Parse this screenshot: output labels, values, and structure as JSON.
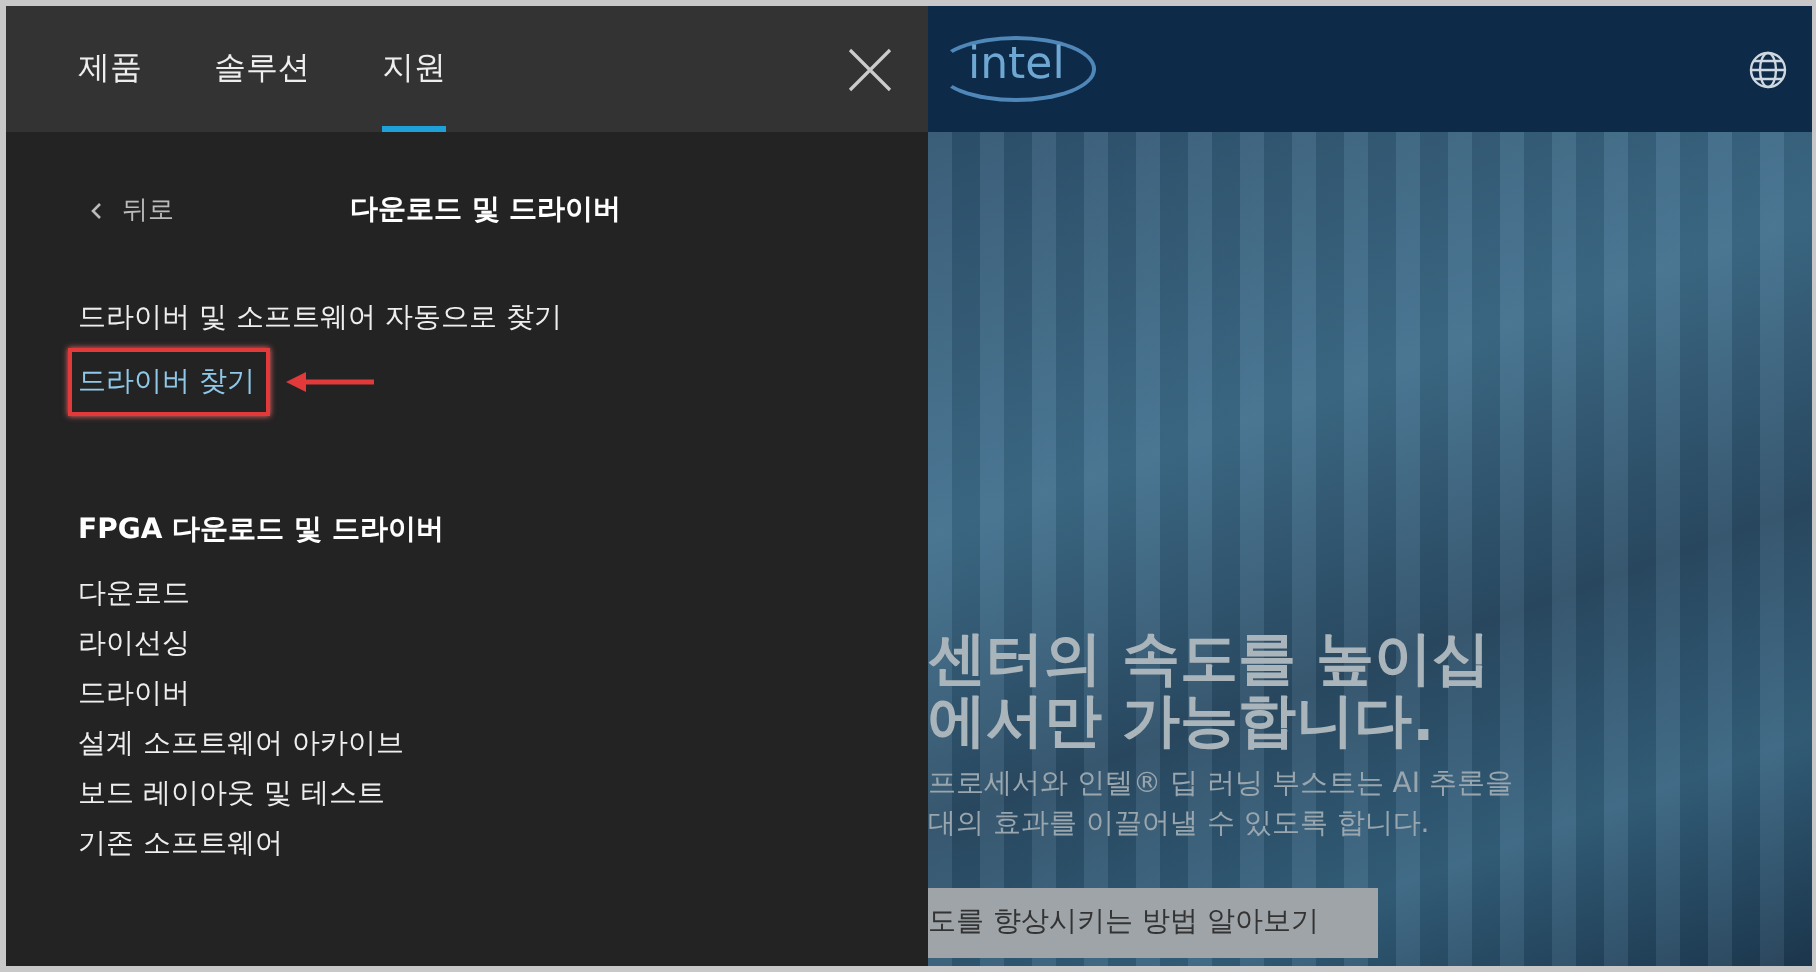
{
  "nav": {
    "tabs": [
      {
        "label": "제품",
        "selected": false
      },
      {
        "label": "솔루션",
        "selected": false
      },
      {
        "label": "지원",
        "selected": true
      }
    ]
  },
  "menu": {
    "back": "뒤로",
    "title": "다운로드 및 드라이버",
    "links": [
      {
        "label": "드라이버 및 소프트웨어 자동으로 찾기",
        "annotated": false
      },
      {
        "label": "드라이버 찾기",
        "annotated": true
      }
    ],
    "section": {
      "heading": "FPGA 다운로드 및 드라이버",
      "items": [
        "다운로드",
        "라이선싱",
        "드라이버",
        "설계 소프트웨어 아카이브",
        "보드 레이아웃 및 테스트",
        "기존 소프트웨어"
      ]
    }
  },
  "site": {
    "logo": "intel",
    "hero": {
      "headline": [
        "센터의 속도를 높이십",
        "에서만 가능합니다."
      ],
      "body": [
        "프로세서와 인텔® 딥 러닝 부스트는 AI 추론을",
        "대의 효과를 이끌어낼 수 있도록 합니다."
      ],
      "button": "도를 향상시키는 방법 알아보기"
    }
  }
}
